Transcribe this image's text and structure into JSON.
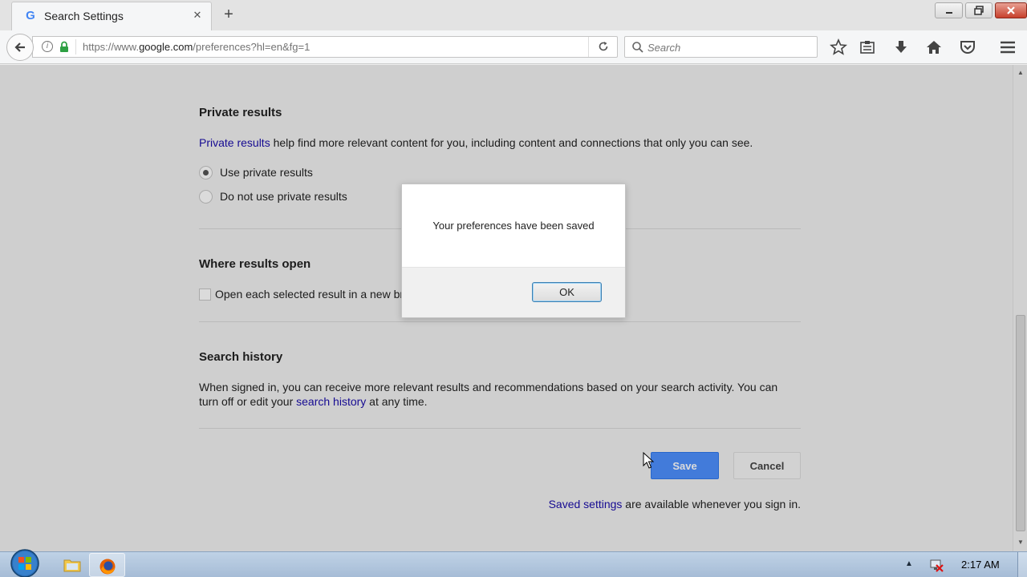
{
  "browser": {
    "tab": {
      "title": "Search Settings",
      "favicon": "G"
    },
    "url": {
      "prefix": "https://www.",
      "host": "google.com",
      "path": "/preferences?hl=en&fg=1"
    },
    "search": {
      "placeholder": "Search"
    }
  },
  "sections": {
    "private": {
      "title": "Private results",
      "desc_link": "Private results",
      "desc_text": " help find more relevant content for you, including content and connections that only you can see.",
      "options": [
        {
          "label": "Use private results",
          "selected": true
        },
        {
          "label": "Do not use private results",
          "selected": false
        }
      ]
    },
    "open": {
      "title": "Where results open",
      "checkbox_label": "Open each selected result in a new browser window"
    },
    "history": {
      "title": "Search history",
      "text_before": "When signed in, you can receive more relevant results and recommendations based on your search activity. You can turn off or edit your ",
      "link": "search history",
      "text_after": " at any time."
    }
  },
  "actions": {
    "save": "Save",
    "cancel": "Cancel",
    "saved_link": "Saved settings",
    "saved_text": " are available whenever you sign in."
  },
  "dialog": {
    "message": "Your preferences have been saved",
    "ok": "OK"
  },
  "taskbar": {
    "clock": "2:17 AM"
  },
  "colors": {
    "link": "#1a0dab",
    "save_button": "#4d90fe"
  }
}
